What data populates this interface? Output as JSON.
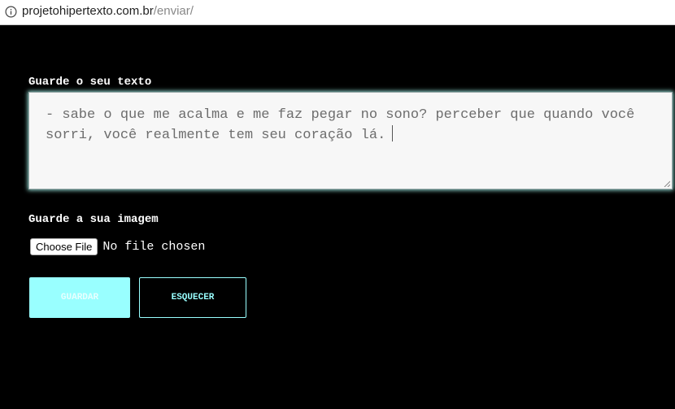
{
  "browser": {
    "url_host": "projetohipertexto.com.br",
    "url_path": "/enviar/",
    "info_icon": "info-circle-icon"
  },
  "form": {
    "text_label": "Guarde o seu texto",
    "text_value": "- sabe o que me acalma e me faz pegar no sono? perceber que quando você sorri, você realmente tem seu coração lá.",
    "image_label": "Guarde a sua imagem",
    "choose_file_label": "Choose File",
    "file_status": "No file chosen",
    "save_label": "GUARDAR",
    "forget_label": "ESQUECER"
  },
  "colors": {
    "background": "#000000",
    "accent": "#99ffff",
    "textarea_bg": "#f7f7f7"
  }
}
